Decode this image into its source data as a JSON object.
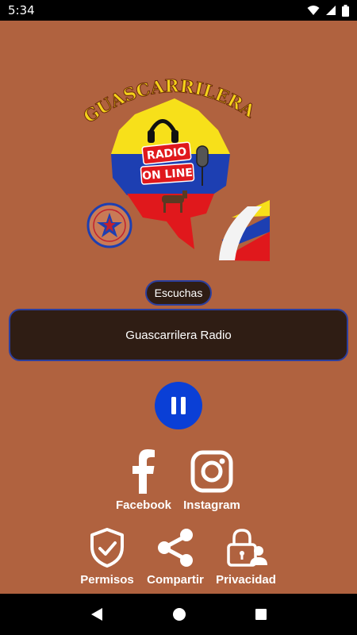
{
  "status_bar": {
    "time": "5:34"
  },
  "logo": {
    "arc_text": "GUASCARRILERA",
    "badge_top": "RADIO",
    "badge_bottom": "ON LINE"
  },
  "listeners_label": "Escuchas",
  "station_name": "Guascarrilera Radio",
  "player": {
    "state": "playing",
    "icon": "pause-icon"
  },
  "social": {
    "facebook": "Facebook",
    "instagram": "Instagram"
  },
  "actions": {
    "permisos": "Permisos",
    "compartir": "Compartir",
    "privacidad": "Privacidad"
  },
  "colors": {
    "background": "#b0623f",
    "panel": "#2f1d14",
    "border": "#2c3f9e",
    "play_button": "#0a3fd6"
  }
}
